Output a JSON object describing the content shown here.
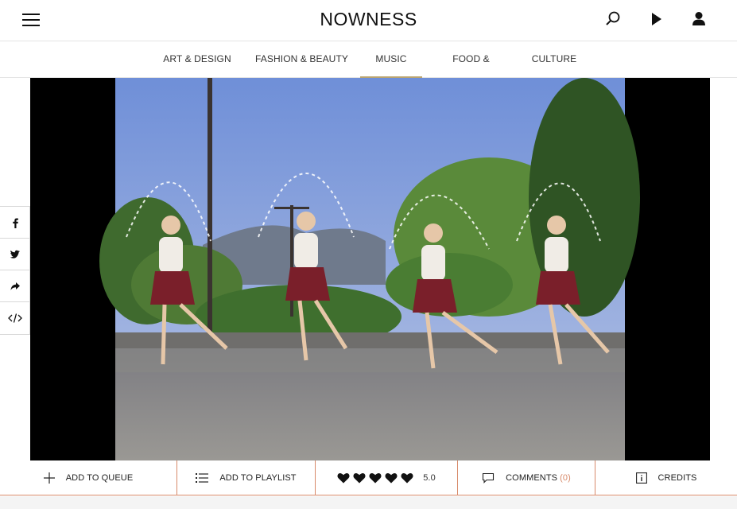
{
  "header": {
    "logo": "NOWNESS",
    "menu_icon": "hamburger-menu-icon",
    "search_icon": "search-icon",
    "play_icon": "play-icon",
    "user_icon": "user-icon"
  },
  "nav": {
    "items": [
      {
        "label": "ART & DESIGN",
        "active": false
      },
      {
        "label": "FASHION & BEAUTY",
        "active": false
      },
      {
        "label": "MUSIC",
        "active": true
      },
      {
        "label": "FOOD & TRAVEL",
        "active": false
      },
      {
        "label": "CULTURE",
        "active": false
      }
    ],
    "accent_color": "#b9a470"
  },
  "share": {
    "items": [
      "facebook-icon",
      "twitter-icon",
      "share-arrow-icon",
      "embed-code-icon"
    ]
  },
  "actions": {
    "queue_label": "ADD TO QUEUE",
    "playlist_label": "ADD TO PLAYLIST",
    "rating_value": "5.0",
    "rating_hearts": 5,
    "comments_label": "COMMENTS",
    "comments_count": "(0)",
    "credits_label": "CREDITS",
    "accent_color": "#d88a6a"
  }
}
